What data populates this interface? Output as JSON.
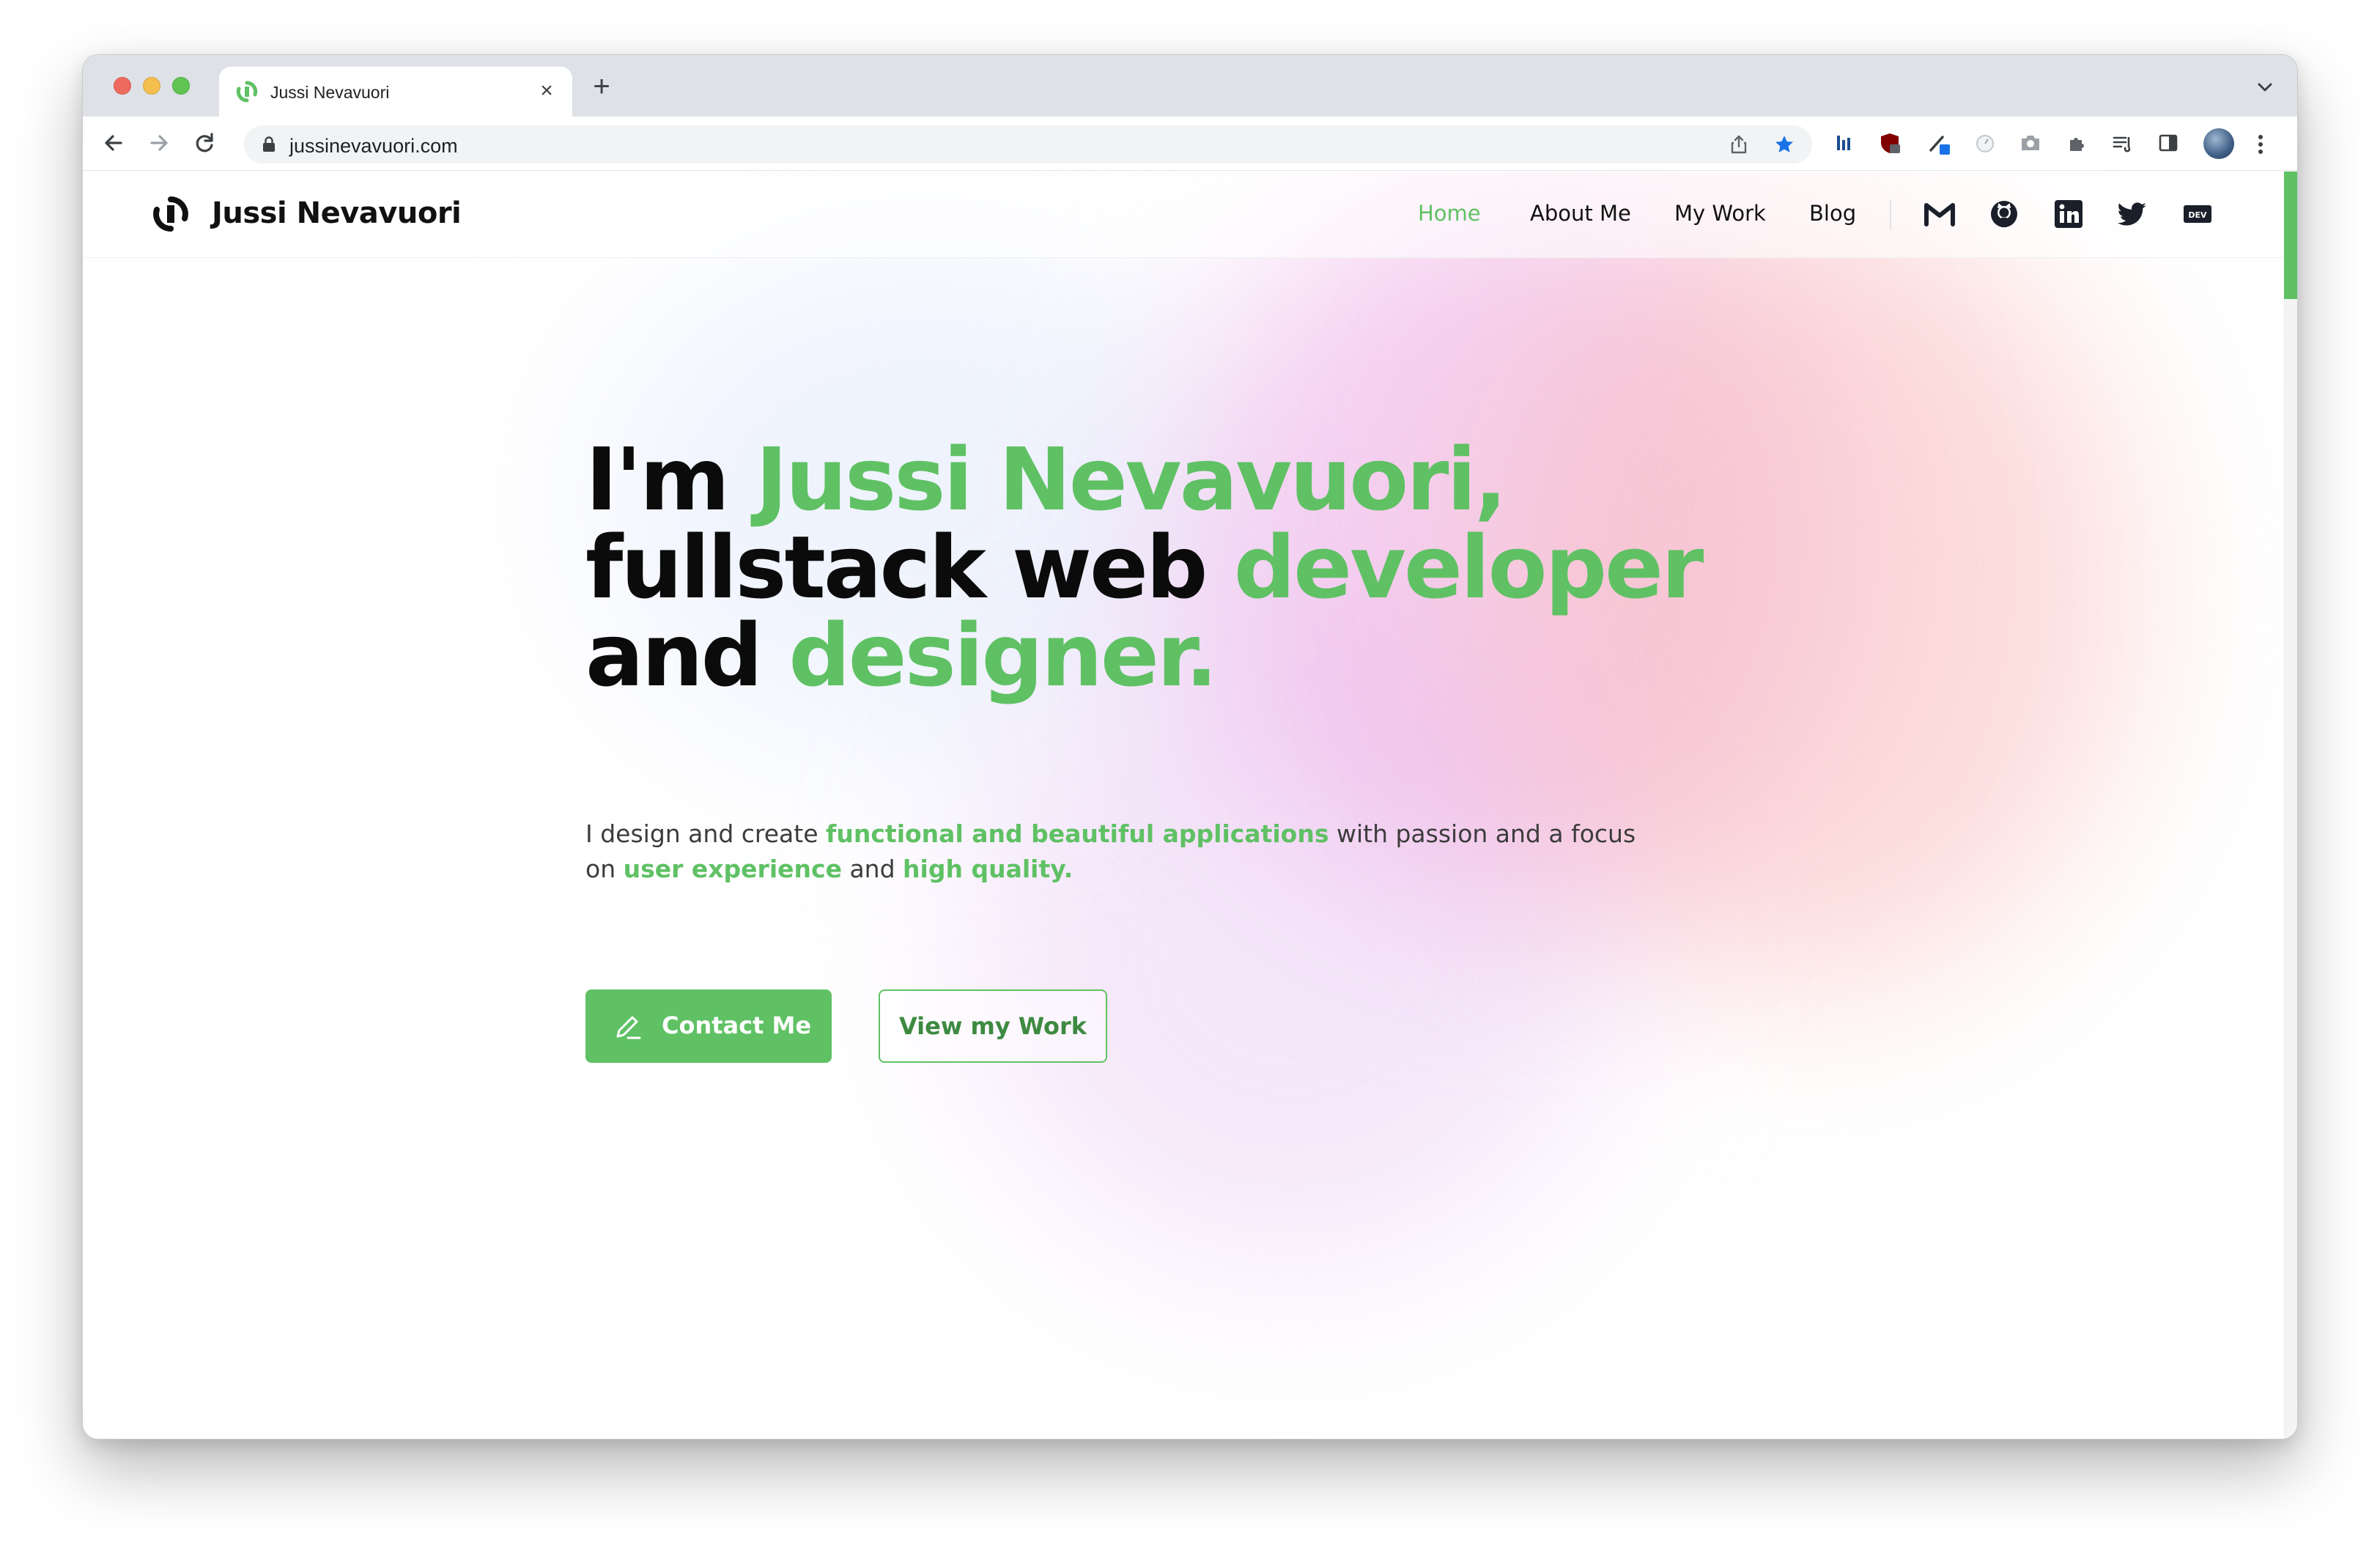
{
  "browser": {
    "tab_title": "Jussi Nevavuori",
    "tab_close": "×",
    "new_tab": "+",
    "url": "jussinevavuori.com"
  },
  "site": {
    "name": "Jussi Nevavuori",
    "nav": [
      {
        "label": "Home",
        "active": true
      },
      {
        "label": "About Me",
        "active": false
      },
      {
        "label": "My Work",
        "active": false
      },
      {
        "label": "Blog",
        "active": false
      }
    ],
    "social": [
      "gmail-icon",
      "github-icon",
      "linkedin-icon",
      "twitter-icon",
      "dev-icon"
    ],
    "dev_badge": "DEV"
  },
  "hero": {
    "line1_a": "I'm ",
    "line1_b": "Jussi Nevavuori,",
    "line2_a": "fullstack web ",
    "line2_b": "developer",
    "line3_a": "and ",
    "line3_b": "designer.",
    "sub_1": "I design and create ",
    "sub_2": "functional and beautiful applications",
    "sub_3": " with passion and a focus on ",
    "sub_4": "user experience",
    "sub_5": " and ",
    "sub_6": "high quality.",
    "primary_button": "Contact Me",
    "secondary_button": "View my Work"
  },
  "colors": {
    "accent": "#5fc164",
    "text": "#0b0b0b"
  }
}
